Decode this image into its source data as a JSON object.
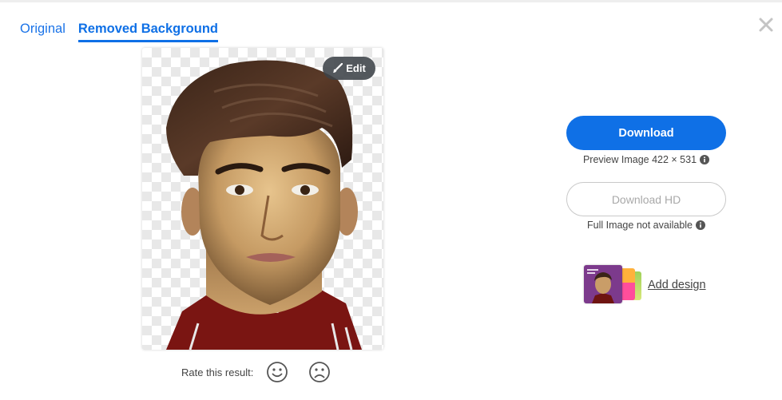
{
  "tabs": [
    {
      "label": "Original",
      "active": false
    },
    {
      "label": "Removed Background",
      "active": true
    }
  ],
  "close_icon": "close-icon",
  "preview": {
    "edit_label": "Edit",
    "edit_icon": "brush-icon"
  },
  "rating": {
    "label": "Rate this result:",
    "happy_icon": "smiley-icon",
    "sad_icon": "frown-icon"
  },
  "download": {
    "label": "Download",
    "info": "Preview Image 422 × 531"
  },
  "download_hd": {
    "label": "Download HD",
    "info": "Full Image not available"
  },
  "add_design": {
    "label": "Add design"
  },
  "colors": {
    "accent": "#0f70e6",
    "disabled_text": "#a9a9a9",
    "checker": "#e8e8e8"
  }
}
